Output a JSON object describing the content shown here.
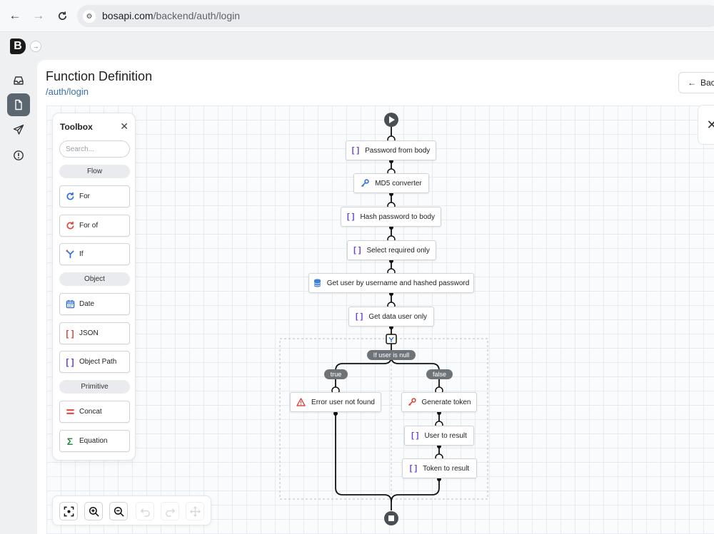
{
  "browser": {
    "url_host": "bosapi.com",
    "url_path": "/backend/auth/login"
  },
  "app": {
    "logo_letter": "B"
  },
  "rail": {
    "items": [
      {
        "name": "inbox-icon",
        "active": false
      },
      {
        "name": "document-icon",
        "active": true
      },
      {
        "name": "send-icon",
        "active": false
      },
      {
        "name": "alert-icon",
        "active": false
      }
    ]
  },
  "header": {
    "title": "Function Definition",
    "subtitle": "/auth/login",
    "back_label": "Bac"
  },
  "toolbox": {
    "title": "Toolbox",
    "search_placeholder": "Search...",
    "sections": [
      {
        "label": "Flow"
      },
      {
        "label": "Object"
      },
      {
        "label": "Primitive"
      }
    ],
    "items": [
      {
        "label": "For",
        "icon": "loop-icon",
        "color": "#2f6fe0"
      },
      {
        "label": "For of",
        "icon": "loop-icon",
        "color": "#e0463b"
      },
      {
        "label": "If",
        "icon": "branch-icon",
        "color": "#2f6fe0"
      },
      {
        "label": "Date",
        "icon": "calendar-icon",
        "color": "#2f6fe0"
      },
      {
        "label": "JSON",
        "icon": "brackets-icon",
        "color": "#e0463b"
      },
      {
        "label": "Object Path",
        "icon": "brackets-icon",
        "color": "#6b3fd8"
      },
      {
        "label": "Concat",
        "icon": "equals-icon",
        "color": "#e0463b"
      },
      {
        "label": "Equation",
        "icon": "sigma-icon",
        "color": "#2f8a44"
      }
    ]
  },
  "flow": {
    "nodes": [
      {
        "label": "Password from body",
        "icon": "brackets-icon"
      },
      {
        "label": "MD5 converter",
        "icon": "key-icon"
      },
      {
        "label": "Hash password to body",
        "icon": "brackets-icon"
      },
      {
        "label": "Select required only",
        "icon": "brackets-icon"
      },
      {
        "label": "Get user by username and hashed password",
        "icon": "database-icon"
      },
      {
        "label": "Get data user only",
        "icon": "brackets-icon"
      },
      {
        "label": "Error user not found",
        "icon": "warning-icon"
      },
      {
        "label": "Generate token",
        "icon": "key-icon"
      },
      {
        "label": "User to result",
        "icon": "brackets-icon"
      },
      {
        "label": "Token to result",
        "icon": "brackets-icon"
      }
    ],
    "condition_label": "If user is null",
    "true_label": "true",
    "false_label": "false"
  },
  "zoom": {
    "buttons": [
      {
        "name": "fit-view-icon",
        "enabled": true
      },
      {
        "name": "zoom-in-icon",
        "enabled": true
      },
      {
        "name": "zoom-out-icon",
        "enabled": true
      },
      {
        "name": "undo-icon",
        "enabled": false
      },
      {
        "name": "redo-icon",
        "enabled": false
      },
      {
        "name": "move-icon",
        "enabled": false
      }
    ]
  }
}
